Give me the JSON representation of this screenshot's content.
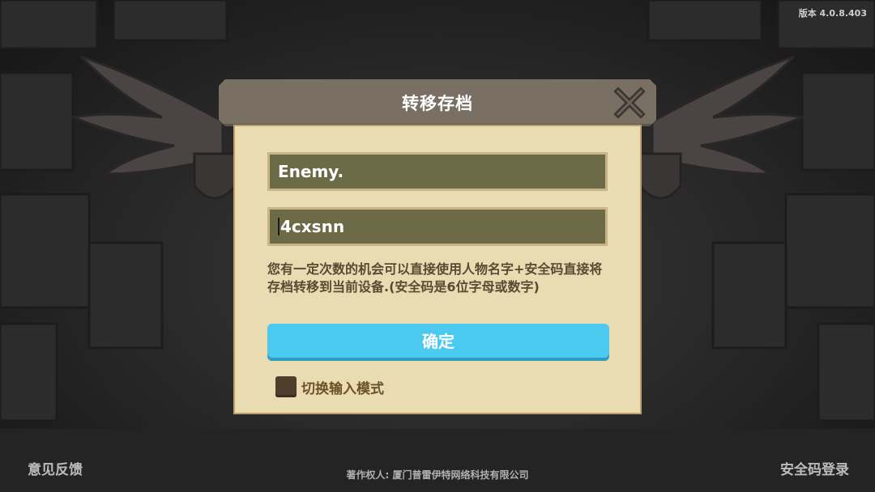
{
  "version": "版本 4.0.8.403",
  "dialog": {
    "title": "转移存档",
    "name_value": "Enemy.",
    "code_value": "4cxsnn",
    "hint": "您有一定次数的机会可以直接使用人物名字+安全码直接将存档转移到当前设备.(安全码是6位字母或数字)",
    "confirm_label": "确定",
    "toggle_label": "切换输入模式"
  },
  "footer": {
    "feedback": "意见反馈",
    "copyright": "著作权人: 厦门普雷伊特网络科技有限公司",
    "safecode_login": "安全码登录"
  },
  "icons": {
    "close": "close-x-icon",
    "toggle": "checkbox-icon"
  },
  "colors": {
    "header": "#7a6f63",
    "panel": "#e9dbb2",
    "field": "#6d6a48",
    "confirm": "#4bc9ef"
  }
}
